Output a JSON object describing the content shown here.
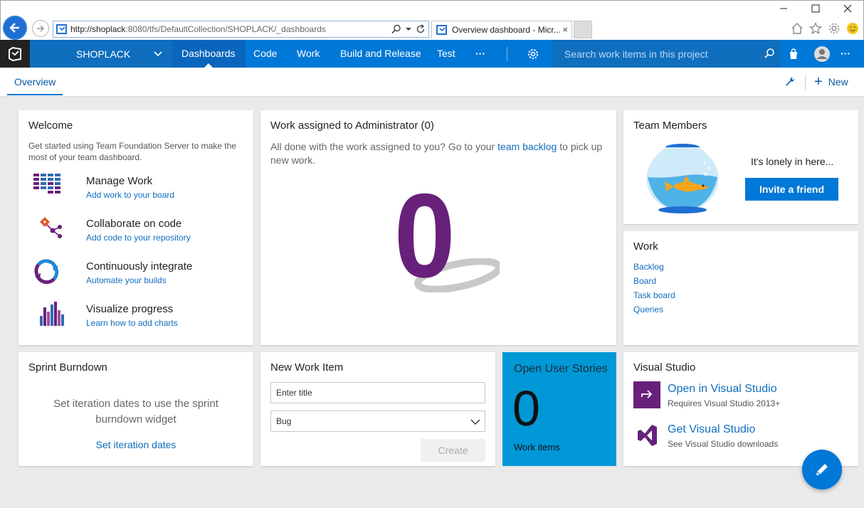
{
  "browser": {
    "url_host": "http://shoplack",
    "url_path": ":8080/tfs/DefaultCollection/SHOPLACK/_dashboards",
    "tab_title": "Overview dashboard - Micr...",
    "tab_close": "×"
  },
  "header": {
    "project": "SHOPLACK",
    "nav": [
      "Dashboards",
      "Code",
      "Work",
      "Build and Release",
      "Test",
      "···"
    ],
    "search_placeholder": "Search work items in this project",
    "more": "···",
    "accent": "#0078d7"
  },
  "subheader": {
    "tab": "Overview",
    "new_label": "New"
  },
  "welcome": {
    "title": "Welcome",
    "intro": "Get started using Team Foundation Server to make the most of your team dashboard.",
    "items": [
      {
        "title": "Manage Work",
        "link": "Add work to your board",
        "icon": "board-icon"
      },
      {
        "title": "Collaborate on code",
        "link": "Add code to your repository",
        "icon": "git-icon"
      },
      {
        "title": "Continuously integrate",
        "link": "Automate your builds",
        "icon": "build-icon"
      },
      {
        "title": "Visualize progress",
        "link": "Learn how to add charts",
        "icon": "chart-icon"
      }
    ]
  },
  "assigned": {
    "title": "Work assigned to Administrator (0)",
    "text_before": "All done with the work assigned to you? Go to your ",
    "link": "team backlog",
    "text_after": " to pick up new work.",
    "count": "0",
    "color": "#68217a"
  },
  "team": {
    "title": "Team Members",
    "lonely": "It's lonely in here...",
    "invite": "Invite a friend"
  },
  "work": {
    "title": "Work",
    "links": [
      "Backlog",
      "Board",
      "Task board",
      "Queries"
    ]
  },
  "sprint": {
    "title": "Sprint Burndown",
    "text": "Set iteration dates to use the sprint burndown widget",
    "link": "Set iteration dates"
  },
  "newitem": {
    "title": "New Work Item",
    "input_placeholder": "Enter title",
    "type": "Bug",
    "create": "Create"
  },
  "stories": {
    "title": "Open User Stories",
    "count": "0",
    "sub": "Work items",
    "color": "#0098d6"
  },
  "vs": {
    "title": "Visual Studio",
    "open_title": "Open in Visual Studio",
    "open_sub": "Requires Visual Studio 2013+",
    "get_title": "Get Visual Studio",
    "get_sub": "See Visual Studio downloads"
  }
}
